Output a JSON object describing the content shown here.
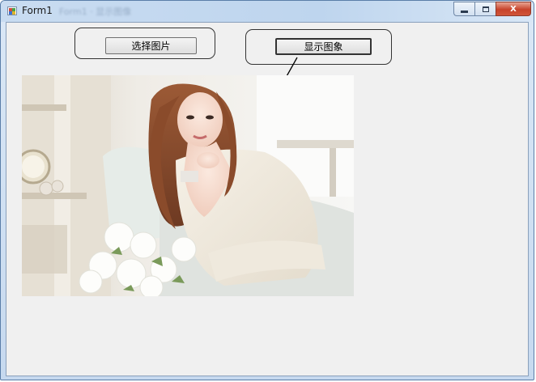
{
  "window": {
    "title": "Form1",
    "background_title_blurred": "Form1 · 显示图像",
    "close_glyph": "X"
  },
  "buttons": {
    "select_image": "选择图片",
    "show_image": "显示图象"
  },
  "colors": {
    "titlebar": "#c6d9ef",
    "client_bg": "#f0f0f0",
    "close_button": "#c7432a"
  }
}
